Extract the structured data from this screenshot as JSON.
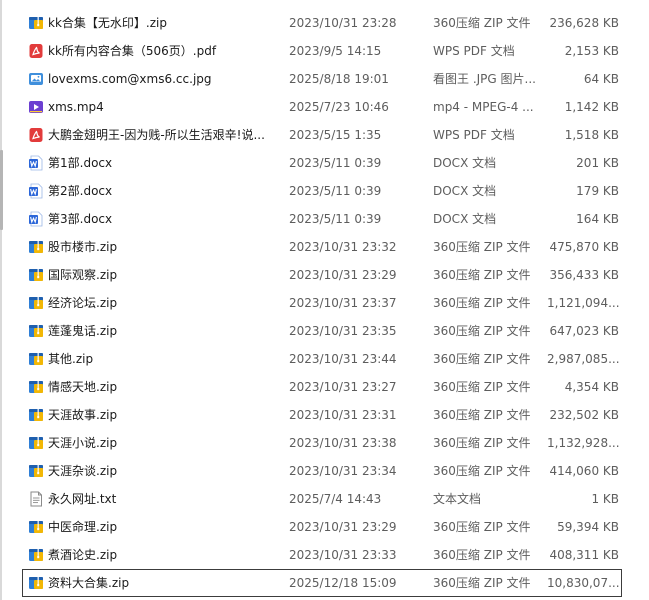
{
  "files": [
    {
      "name": "kk合集【无水印】.zip",
      "date": "2023/10/31 23:28",
      "type": "360压缩 ZIP 文件",
      "size": "236,628 KB",
      "icon": "zip-archive-icon"
    },
    {
      "name": "kk所有内容合集（506页）.pdf",
      "date": "2023/9/5 14:15",
      "type": "WPS PDF 文档",
      "size": "2,153 KB",
      "icon": "pdf-file-icon"
    },
    {
      "name": "lovexms.com@xms6.cc.jpg",
      "date": "2025/8/18 19:01",
      "type": "看图王 .JPG 图片...",
      "size": "64 KB",
      "icon": "image-file-icon"
    },
    {
      "name": "xms.mp4",
      "date": "2025/7/23 10:46",
      "type": "mp4 - MPEG-4 ...",
      "size": "1,142 KB",
      "icon": "video-file-icon"
    },
    {
      "name": "大鹏金翅明王-因为贱-所以生活艰辛!说...",
      "date": "2023/5/15 1:35",
      "type": "WPS PDF 文档",
      "size": "1,518 KB",
      "icon": "pdf-file-icon"
    },
    {
      "name": "第1部.docx",
      "date": "2023/5/11 0:39",
      "type": "DOCX 文档",
      "size": "201 KB",
      "icon": "word-doc-icon"
    },
    {
      "name": "第2部.docx",
      "date": "2023/5/11 0:39",
      "type": "DOCX 文档",
      "size": "179 KB",
      "icon": "word-doc-icon"
    },
    {
      "name": "第3部.docx",
      "date": "2023/5/11 0:39",
      "type": "DOCX 文档",
      "size": "164 KB",
      "icon": "word-doc-icon"
    },
    {
      "name": "股市楼市.zip",
      "date": "2023/10/31 23:32",
      "type": "360压缩 ZIP 文件",
      "size": "475,870 KB",
      "icon": "zip-archive-icon"
    },
    {
      "name": "国际观察.zip",
      "date": "2023/10/31 23:29",
      "type": "360压缩 ZIP 文件",
      "size": "356,433 KB",
      "icon": "zip-archive-icon"
    },
    {
      "name": "经济论坛.zip",
      "date": "2023/10/31 23:37",
      "type": "360压缩 ZIP 文件",
      "size": "1,121,094...",
      "icon": "zip-archive-icon"
    },
    {
      "name": "莲蓬鬼话.zip",
      "date": "2023/10/31 23:35",
      "type": "360压缩 ZIP 文件",
      "size": "647,023 KB",
      "icon": "zip-archive-icon"
    },
    {
      "name": "其他.zip",
      "date": "2023/10/31 23:44",
      "type": "360压缩 ZIP 文件",
      "size": "2,987,085...",
      "icon": "zip-archive-icon"
    },
    {
      "name": "情感天地.zip",
      "date": "2023/10/31 23:27",
      "type": "360压缩 ZIP 文件",
      "size": "4,354 KB",
      "icon": "zip-archive-icon"
    },
    {
      "name": "天涯故事.zip",
      "date": "2023/10/31 23:31",
      "type": "360压缩 ZIP 文件",
      "size": "232,502 KB",
      "icon": "zip-archive-icon"
    },
    {
      "name": "天涯小说.zip",
      "date": "2023/10/31 23:38",
      "type": "360压缩 ZIP 文件",
      "size": "1,132,928...",
      "icon": "zip-archive-icon"
    },
    {
      "name": "天涯杂谈.zip",
      "date": "2023/10/31 23:34",
      "type": "360压缩 ZIP 文件",
      "size": "414,060 KB",
      "icon": "zip-archive-icon"
    },
    {
      "name": "永久网址.txt",
      "date": "2025/7/4 14:43",
      "type": "文本文档",
      "size": "1 KB",
      "icon": "text-file-icon"
    },
    {
      "name": "中医命理.zip",
      "date": "2023/10/31 23:29",
      "type": "360压缩 ZIP 文件",
      "size": "59,394 KB",
      "icon": "zip-archive-icon"
    },
    {
      "name": "煮酒论史.zip",
      "date": "2023/10/31 23:33",
      "type": "360压缩 ZIP 文件",
      "size": "408,311 KB",
      "icon": "zip-archive-icon"
    },
    {
      "name": "资料大合集.zip",
      "date": "2025/12/18 15:09",
      "type": "360压缩 ZIP 文件",
      "size": "10,830,07...",
      "icon": "zip-archive-icon",
      "selected": true
    }
  ],
  "colors": {
    "zip_blue": "#2f7fd6",
    "zip_yellow": "#f2b705",
    "pdf_red": "#e23b3b",
    "image_blue": "#3f8fdc",
    "video_purple": "#6b3fd1",
    "word_blue": "#2b66d9",
    "text_gray": "#8a8a8a"
  }
}
